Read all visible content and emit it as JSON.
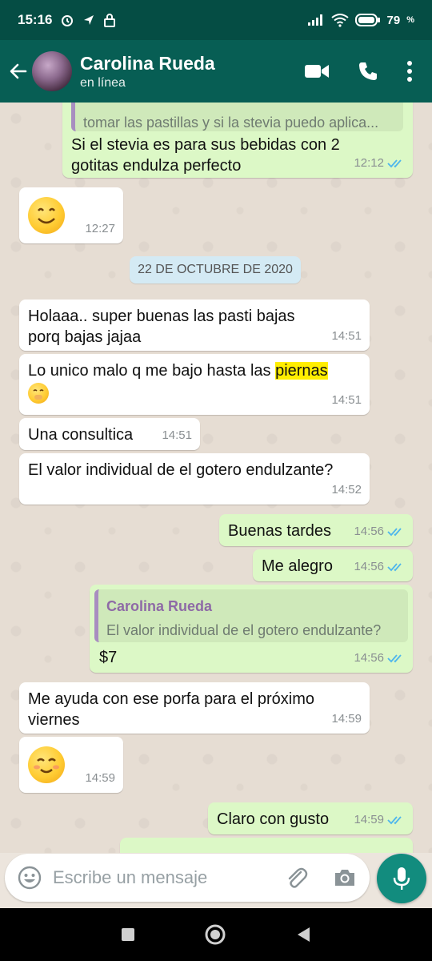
{
  "status_bar": {
    "time": "15:16",
    "battery": "79"
  },
  "header": {
    "contact_name": "Carolina Rueda",
    "contact_status": "en línea"
  },
  "messages": [
    {
      "id": "m1",
      "dir": "out",
      "quoted_text": "tomar las pastillas y si la stevia puedo aplica...",
      "text": "Si el stevia es para sus bebidas con 2 gotitas endulza perfecto",
      "time": "12:12"
    },
    {
      "id": "m2",
      "dir": "in",
      "emoji": "smiling-face-icon",
      "time": "12:27"
    },
    {
      "id": "m3",
      "dir": "in",
      "text": "Holaaa.. super buenas las pasti bajas porq bajas jajaa",
      "time": "14:51"
    },
    {
      "id": "m4",
      "dir": "in",
      "text_before": "Lo unico malo q me bajo hasta las ",
      "text_highlight": "piernas",
      "emoji": "hand-over-mouth-icon",
      "time": "14:51"
    },
    {
      "id": "m5",
      "dir": "in",
      "text": "Una consultica",
      "time": "14:51"
    },
    {
      "id": "m6",
      "dir": "in",
      "text": "El valor individual de el gotero endulzante?",
      "time": "14:52"
    },
    {
      "id": "m7",
      "dir": "out",
      "text": "Buenas tardes",
      "time": "14:56"
    },
    {
      "id": "m8",
      "dir": "out",
      "text": "Me alegro",
      "time": "14:56"
    },
    {
      "id": "m9",
      "dir": "out",
      "quoted_author": "Carolina Rueda",
      "quoted_text": "El valor individual de el gotero endulzante?",
      "text": "$7",
      "time": "14:56"
    },
    {
      "id": "m10",
      "dir": "in",
      "text": "Me ayuda con ese porfa para el próximo viernes",
      "time": "14:59"
    },
    {
      "id": "m11",
      "dir": "in",
      "emoji": "smiling-blush-icon",
      "time": "14:59"
    },
    {
      "id": "m12",
      "dir": "out",
      "text": "Claro con gusto",
      "time": "14:59"
    }
  ],
  "date_separator": "22 DE OCTUBRE DE 2020",
  "composer": {
    "placeholder": "Escribe un mensaje"
  },
  "colors": {
    "header": "#075e54",
    "status_bar": "#054d44",
    "outgoing_bubble": "#dcf8c6",
    "incoming_bubble": "#ffffff",
    "read_ticks": "#4fb6ec",
    "mic_button": "#128c7e",
    "highlight": "#ffee00"
  }
}
